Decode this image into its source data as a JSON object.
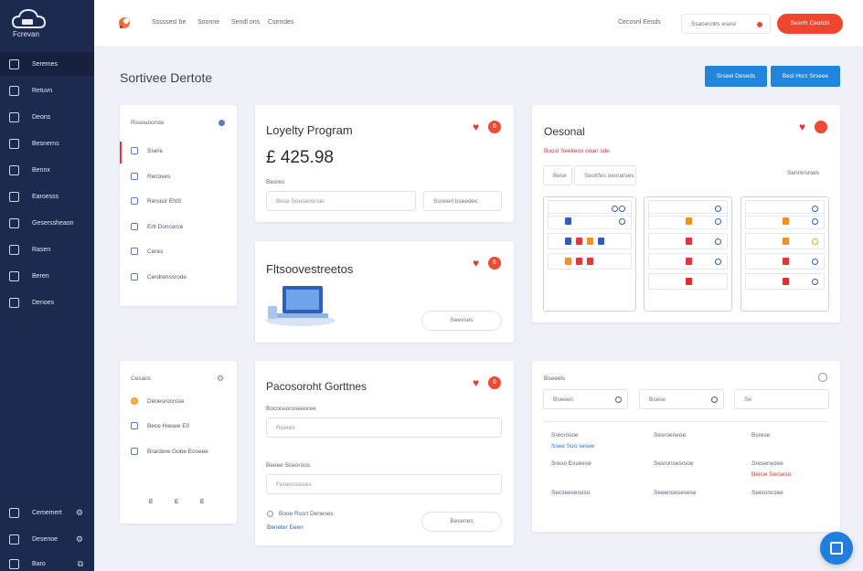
{
  "sidebar": {
    "brand": "Fcrevan",
    "items": [
      {
        "label": "Seremes"
      },
      {
        "label": "Retuvn"
      },
      {
        "label": "Deons"
      },
      {
        "label": "Besnerns"
      },
      {
        "label": "Bennx"
      },
      {
        "label": "Earoesss"
      },
      {
        "label": "Geserssheaon"
      },
      {
        "label": "Rasen"
      },
      {
        "label": "Beren"
      },
      {
        "label": "Denoes"
      }
    ],
    "bottom": [
      {
        "label": "Cememert"
      },
      {
        "label": "Desenoe"
      },
      {
        "label": "Baro"
      }
    ]
  },
  "topbar": {
    "links": [
      "Sssssesl be",
      "Soonne",
      "Sendl ons",
      "Cserrdes"
    ],
    "language": "Cecosnl Eesds",
    "search_placeholder": "Ssacecnbs esesl",
    "cta": "Sesrrh Ceorcls"
  },
  "page": {
    "title": "Sortivee Dertote",
    "button_primary": "Srseel Deseds",
    "button_secondary": "Besl Hsrz Srseee"
  },
  "menu_card": {
    "title": "Rsseuoorste",
    "items": [
      "Ssere",
      "Recoves",
      "Rersisir ENS",
      "Ertl Doncorce",
      "Ceres",
      "Cerdrenssrode"
    ]
  },
  "loyalty": {
    "title": "Loyelty Program",
    "amount": "£ 425.98",
    "badge": "6",
    "label": "Besres",
    "input_placeholder": "Bese Seeseoorsle",
    "button": "Ssneerl bseedes"
  },
  "promo": {
    "title": "Fltsoovestreetos",
    "badge": "6",
    "button": "Seevses"
  },
  "general": {
    "title": "Oesonal",
    "subtitle": "Boosl Seekeos ooan sde",
    "tabs": [
      "Bese",
      "Sestrfes oeorarses"
    ],
    "tab_right": "Senrorsrses"
  },
  "contacts": {
    "title": "Cesaos",
    "items": [
      "Deoesrocrose",
      "Bece Haswe E0",
      "Brardere Gobe Eoseee"
    ],
    "footer": [
      "E",
      "E",
      "E"
    ]
  },
  "program_settings": {
    "title": "Pacosoroht Gorttnes",
    "badge": "6",
    "label1": "Bococeoroseeoree",
    "placeholder1": "Rseres",
    "label2": "Beeee Sceoroos",
    "placeholder2": "Feoecososes",
    "checkbox_label": "Booe Rssrt Deneses",
    "link": "Beneter Eeen",
    "button": "Besenes"
  },
  "details": {
    "title": "Bseeels",
    "filters": [
      "Bseeen",
      "Bsese",
      "Se"
    ],
    "rows": [
      [
        "Srecrosoe",
        "Sesroeneoe",
        "Bsrese"
      ],
      [
        "Sreso Esseese",
        "Sesronsesrsoe",
        "Sresenesee"
      ],
      [
        "Secseesesoso",
        "Seeenoesesese",
        "Seeroncsee"
      ]
    ],
    "links": [
      "Ssee Soo sesee",
      "Beroe Seroeso"
    ]
  }
}
